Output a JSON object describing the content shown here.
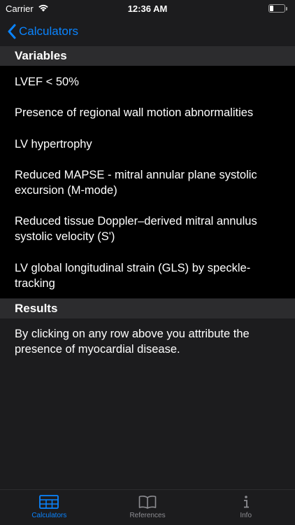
{
  "status_bar": {
    "carrier": "Carrier",
    "time": "12:36 AM"
  },
  "nav": {
    "back_label": "Calculators"
  },
  "sections": {
    "variables": "Variables",
    "results": "Results"
  },
  "variables": [
    "LVEF < 50%",
    "Presence of regional wall motion abnormalities",
    "LV hypertrophy",
    "Reduced MAPSE - mitral annular plane systolic excursion (M-mode)",
    "Reduced tissue Doppler–derived mitral annulus systolic velocity (S')",
    "LV global longitudinal strain (GLS) by speckle-tracking"
  ],
  "results_text": "By clicking on any row above you attribute the presence of myocardial disease.",
  "tabs": [
    {
      "label": "Calculators",
      "icon": "table-icon",
      "active": true
    },
    {
      "label": "References",
      "icon": "book-icon",
      "active": false
    },
    {
      "label": "Info",
      "icon": "info-icon",
      "active": false
    }
  ],
  "colors": {
    "accent": "#0a84ff",
    "inactive": "#8e8e93",
    "background": "#1c1c1e",
    "section": "#2c2c2e"
  }
}
